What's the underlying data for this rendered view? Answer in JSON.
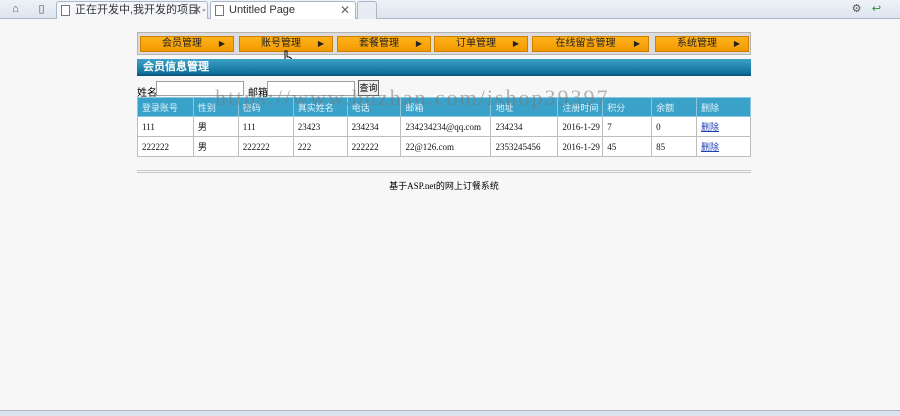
{
  "browser": {
    "tabs": [
      {
        "label": "正在开发中,我开发的项目 - 在"
      },
      {
        "label": "Untitled Page"
      }
    ],
    "close_glyph": "✕"
  },
  "menu": [
    {
      "label": "会员管理"
    },
    {
      "label": "账号管理"
    },
    {
      "label": "套餐管理"
    },
    {
      "label": "订单管理"
    },
    {
      "label": "在线留言管理"
    },
    {
      "label": "系统管理"
    }
  ],
  "menu_arrow": "▶",
  "panel": {
    "title": "会员信息管理"
  },
  "search": {
    "name_label": "姓名:",
    "email_label": "邮箱:",
    "button_label": "查询"
  },
  "table": {
    "headers": [
      "登录账号",
      "性别",
      "密码",
      "真实姓名",
      "电话",
      "邮箱",
      "地址",
      "注册时间",
      "积分",
      "余额",
      "删除"
    ],
    "rows": [
      [
        "111",
        "男",
        "111",
        "23423",
        "234234",
        "234234234@qq.com",
        "234234",
        "2016-1-29",
        "7",
        "0",
        "删除"
      ],
      [
        "222222",
        "男",
        "222222",
        "222",
        "222222",
        "22@126.com",
        "2353245456",
        "2016-1-29",
        "45",
        "85",
        "删除"
      ]
    ]
  },
  "footer": {
    "text": "基于ASP.net的网上订餐系统"
  },
  "watermark": {
    "text": "https://www.huzhan.com/ishop39397"
  }
}
